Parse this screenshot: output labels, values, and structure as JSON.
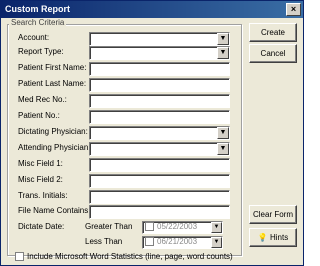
{
  "window": {
    "title": "Custom Report",
    "close_glyph": "×"
  },
  "group": {
    "label": "Search Criteria"
  },
  "fields": [
    {
      "label": "Account:",
      "dropdown": true
    },
    {
      "label": "Report Type:",
      "dropdown": true
    },
    {
      "label": "Patient First Name:",
      "dropdown": false
    },
    {
      "label": "Patient Last Name:",
      "dropdown": false
    },
    {
      "label": "Med Rec No.:",
      "dropdown": false
    },
    {
      "label": "Patient No.:",
      "dropdown": false
    },
    {
      "label": "Dictating Physician:",
      "dropdown": true
    },
    {
      "label": "Attending Physician:",
      "dropdown": true
    },
    {
      "label": "Misc Field 1:",
      "dropdown": false
    },
    {
      "label": "Misc Field 2:",
      "dropdown": false
    },
    {
      "label": "Trans. Initials:",
      "dropdown": false
    },
    {
      "label": "File Name Contains:",
      "dropdown": false
    }
  ],
  "dictate_date": {
    "label": "Dictate Date:",
    "greater_than": {
      "label": "Greater Than",
      "value": "05/22/2003",
      "checked": false
    },
    "less_than": {
      "label": "Less Than",
      "value": "06/21/2003",
      "checked": false
    }
  },
  "word_stats": {
    "label": "Include Microsoft Word Statistics (line, page, word counts)",
    "checked": false
  },
  "buttons": {
    "create": "Create",
    "cancel": "Cancel",
    "clear": "Clear Form",
    "hints": "Hints"
  },
  "icons": {
    "dropdown": "chevron-down-icon",
    "hints": "lightbulb-icon"
  }
}
